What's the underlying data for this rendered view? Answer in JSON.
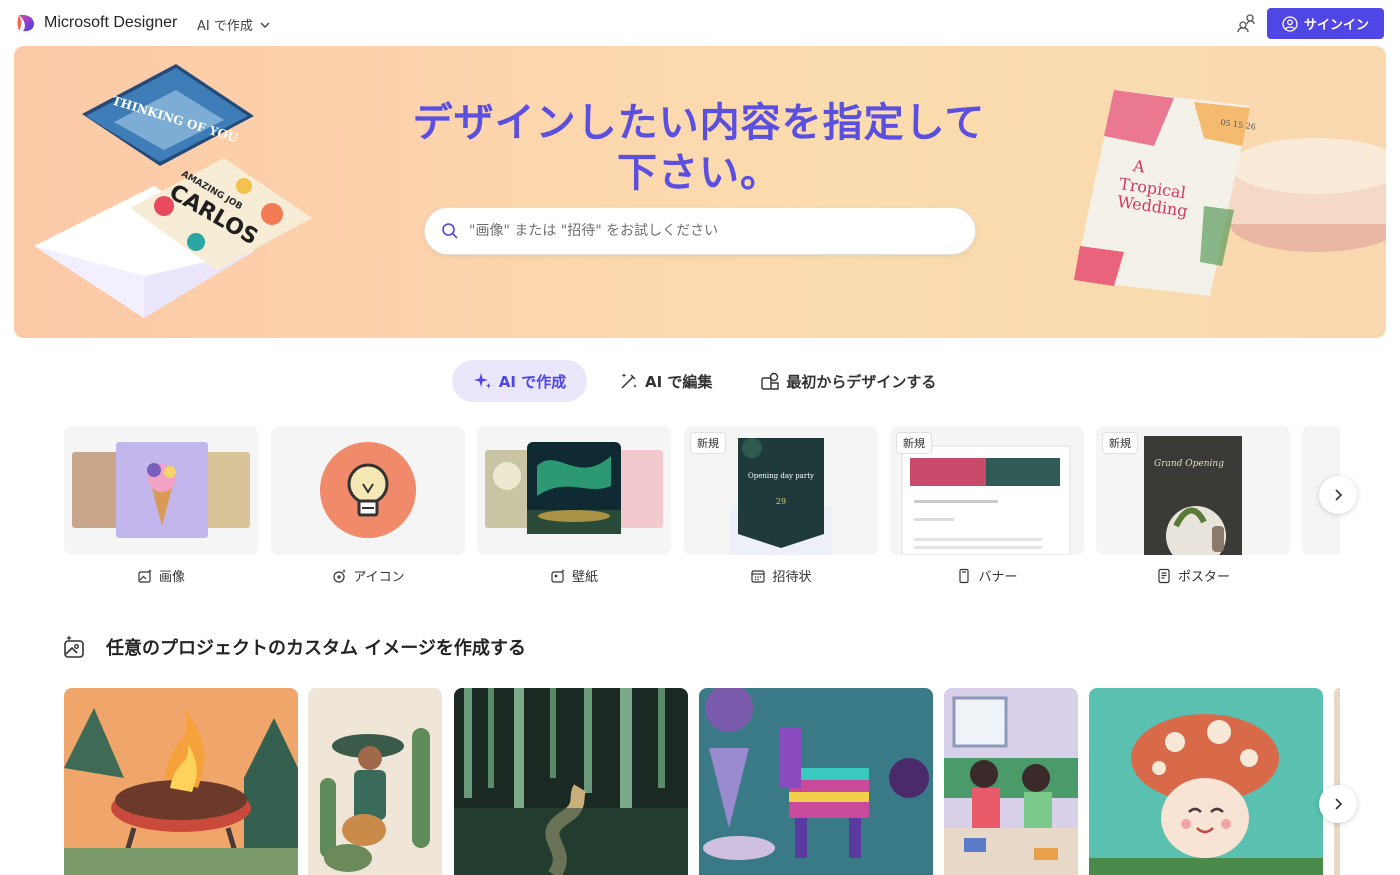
{
  "header": {
    "brand": "Microsoft Designer",
    "create_menu_label": "AI で作成",
    "signin_label": "サインイン"
  },
  "hero": {
    "title_line1": "デザインしたい内容を指定して",
    "title_line2": "下さい。",
    "search_placeholder": "\"画像\" または \"招待\" をお試しください",
    "card_left_top_text": "THINKING OF YOU",
    "card_left_bottom_text_1": "AMAZING JOB",
    "card_left_bottom_text_2": "CARLOS",
    "card_right_title_1": "A",
    "card_right_title_2": "Tropical",
    "card_right_title_3": "Wedding",
    "card_right_date": "05 15 26"
  },
  "tabs": [
    {
      "label": "AI で作成"
    },
    {
      "label": "AI で編集"
    },
    {
      "label": "最初からデザインする"
    }
  ],
  "categories": [
    {
      "label": "画像",
      "badge": ""
    },
    {
      "label": "アイコン",
      "badge": ""
    },
    {
      "label": "壁紙",
      "badge": ""
    },
    {
      "label": "招待状",
      "badge": "新規",
      "thumb_text": "Opening day party"
    },
    {
      "label": "バナー",
      "badge": "新規"
    },
    {
      "label": "ポスター",
      "badge": "新規",
      "thumb_text": "Grand Opening"
    }
  ],
  "section": {
    "title": "任意のプロジェクトのカスタム イメージを作成する"
  },
  "colors": {
    "accent": "#4f46e5",
    "hero_title": "#5b4fe0",
    "active_tab_bg": "#ebe7fb"
  }
}
